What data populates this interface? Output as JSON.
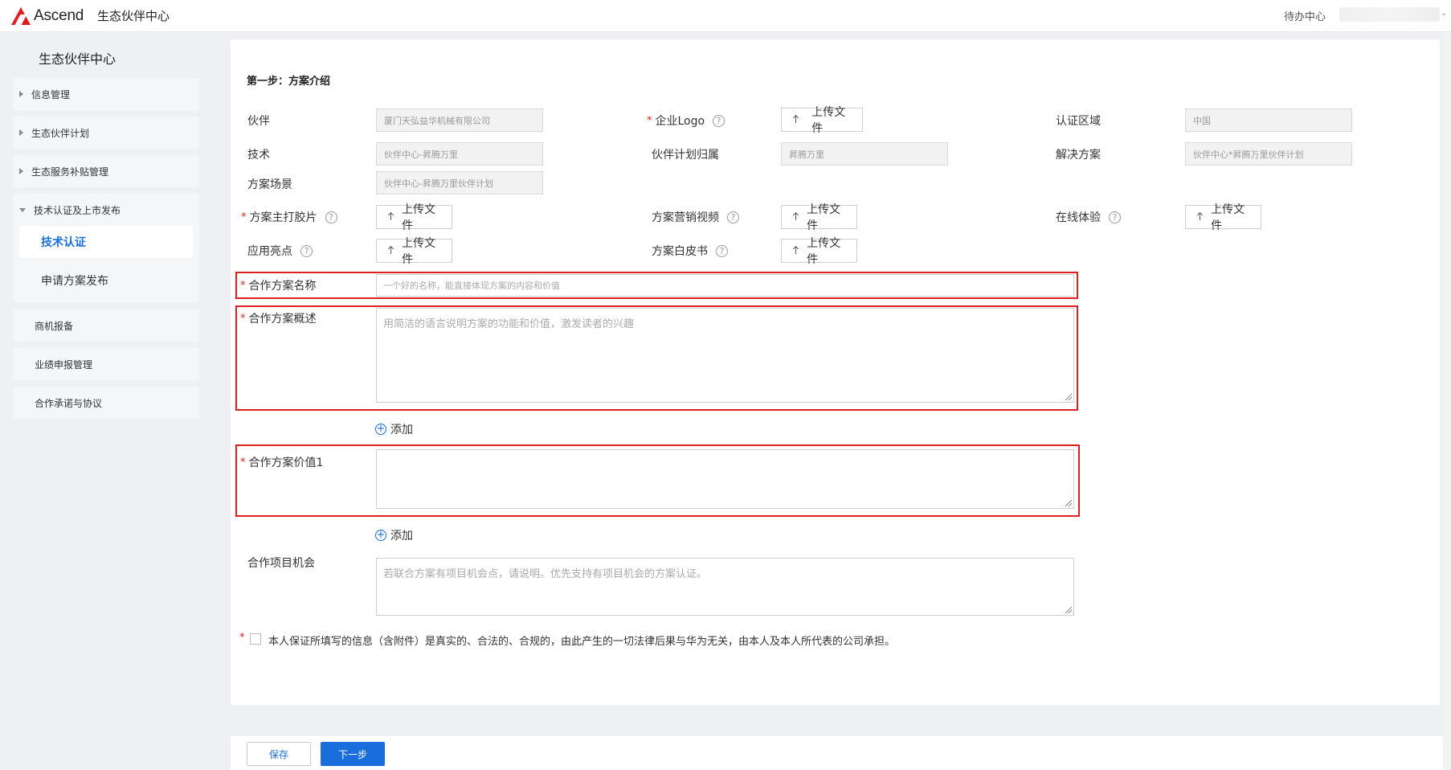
{
  "topbar": {
    "logo": "Ascend",
    "app_title": "生态伙伴中心",
    "todo": "待办中心"
  },
  "sidebar": {
    "title": "生态伙伴中心",
    "items": [
      {
        "label": "信息管理"
      },
      {
        "label": "生态伙伴计划"
      },
      {
        "label": "生态服务补贴管理"
      }
    ],
    "group": {
      "label": "技术认证及上市发布",
      "children": [
        {
          "label": "技术认证",
          "active": true
        },
        {
          "label": "申请方案发布"
        }
      ]
    },
    "items_after": [
      {
        "label": "商机报备"
      },
      {
        "label": "业绩申报管理"
      },
      {
        "label": "合作承诺与协议"
      }
    ]
  },
  "form": {
    "section_title": "第一步：方案介绍",
    "partner": {
      "label": "伙伴",
      "value": "厦门天弘益华机械有限公司"
    },
    "logo": {
      "label": "企业Logo",
      "upload": "上传文件"
    },
    "region": {
      "label": "认证区域",
      "value": "中国"
    },
    "tech": {
      "label": "技术",
      "value": "伙伴中心-昇腾万里"
    },
    "plan": {
      "label": "伙伴计划归属",
      "value": "昇腾万里"
    },
    "solution": {
      "label": "解决方案",
      "value": "伙伴中心*昇腾万里伙伴计划"
    },
    "scene": {
      "label": "方案场景",
      "value": "伙伴中心-昇腾万里伙伴计划"
    },
    "main_slides": {
      "label": "方案主打胶片",
      "upload": "上传文件"
    },
    "marketing_video": {
      "label": "方案营销视频",
      "upload": "上传文件"
    },
    "online_exp": {
      "label": "在线体验",
      "upload": "上传文件"
    },
    "highlights": {
      "label": "应用亮点",
      "upload": "上传文件"
    },
    "whitepaper": {
      "label": "方案白皮书",
      "upload": "上传文件"
    },
    "name": {
      "label": "合作方案名称",
      "placeholder": "一个好的名称，能直接体现方案的内容和价值"
    },
    "overview": {
      "label": "合作方案概述",
      "placeholder": "用简洁的语言说明方案的功能和价值，激发读者的兴趣"
    },
    "add1": "添加",
    "value1": {
      "label": "合作方案价值1",
      "placeholder": ""
    },
    "add2": "添加",
    "opportunity": {
      "label": "合作项目机会",
      "placeholder": "若联合方案有项目机会点，请说明。优先支持有项目机会的方案认证。"
    },
    "agreement": "本人保证所填写的信息（含附件）是真实的、合法的、合规的，由此产生的一切法律后果与华为无关，由本人及本人所代表的公司承担。"
  },
  "footer": {
    "save": "保存",
    "next": "下一步"
  },
  "colors": {
    "primary": "#1a6edb",
    "required": "#e02020",
    "brand": "#e02020"
  }
}
